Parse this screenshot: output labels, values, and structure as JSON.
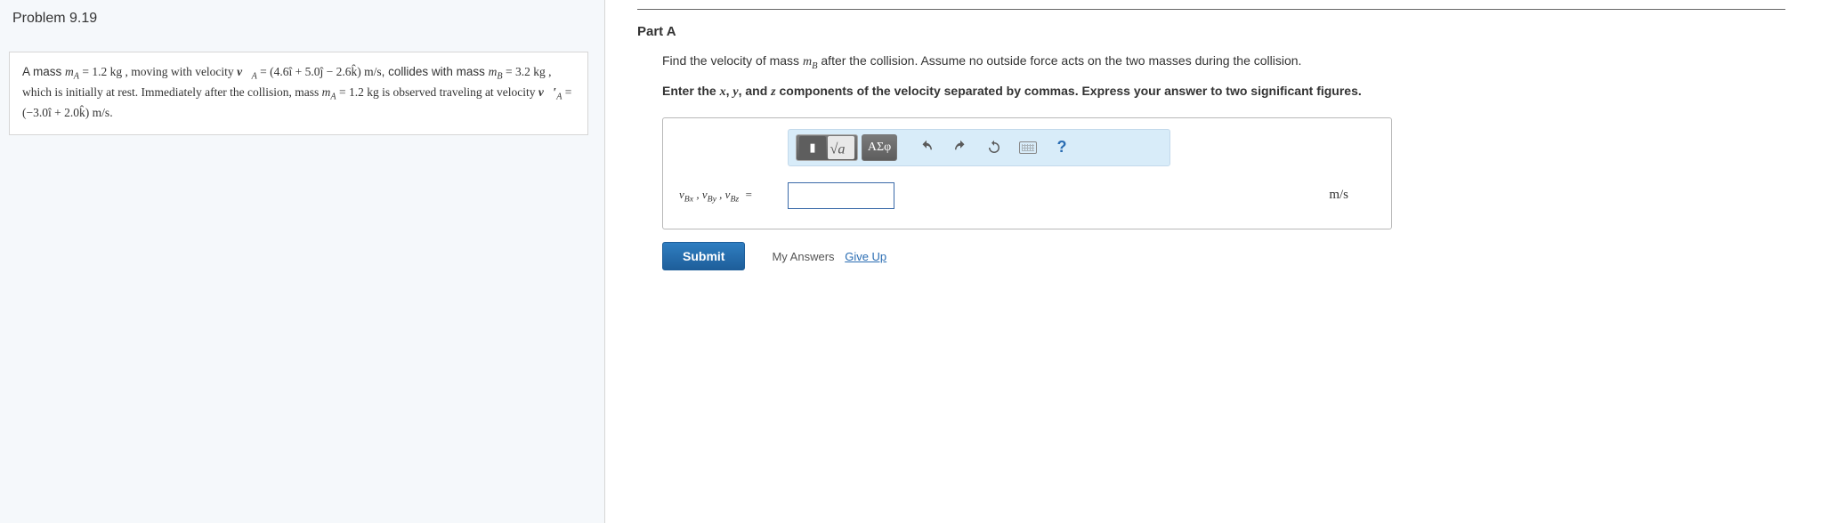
{
  "left": {
    "title": "Problem 9.19",
    "text_1": "A mass ",
    "mA": "m",
    "mA_sub": "A",
    "eq1": " = 1.2 kg , moving with velocity ",
    "vA_sym": "v⃗",
    "vA_sub": "A",
    "vA_eq": " = (4.6î + 5.0ĵ − 2.6k̂) m/s",
    "text_2": ", collides with mass ",
    "mB": "m",
    "mB_sub": "B",
    "eq2": " = 3.2 kg , which is initially at rest. Immediately after the collision, mass ",
    "mA2": "m",
    "mA2_sub": "A",
    "eq3": " = 1.2 kg is observed traveling at velocity ",
    "vAp_sym": "v⃗′",
    "vAp_sub": "A",
    "vAp_eq": " = (−3.0î + 2.0k̂) m/s",
    "text_end": "."
  },
  "right": {
    "part_label": "Part A",
    "instruction1_a": "Find the velocity of mass ",
    "instruction1_mb": "m",
    "instruction1_mb_sub": "B",
    "instruction1_b": " after the collision. Assume no outside force acts on the two masses during the collision.",
    "instruction2_a": "Enter the ",
    "instruction2_x": "x",
    "instruction2_b": ", ",
    "instruction2_y": "y",
    "instruction2_c": ", and ",
    "instruction2_z": "z",
    "instruction2_d": " components of the velocity separated by commas. Express your answer to two significant figures.",
    "toolbar": {
      "templates_dark": "▮",
      "templates_light": "x√a",
      "greek": "ΑΣφ",
      "help": "?"
    },
    "answer_label": "vBx , vBy , vBz  =",
    "answer_value": "",
    "answer_unit": "m/s",
    "submit": "Submit",
    "my_answers": "My Answers",
    "give_up": "Give Up"
  }
}
